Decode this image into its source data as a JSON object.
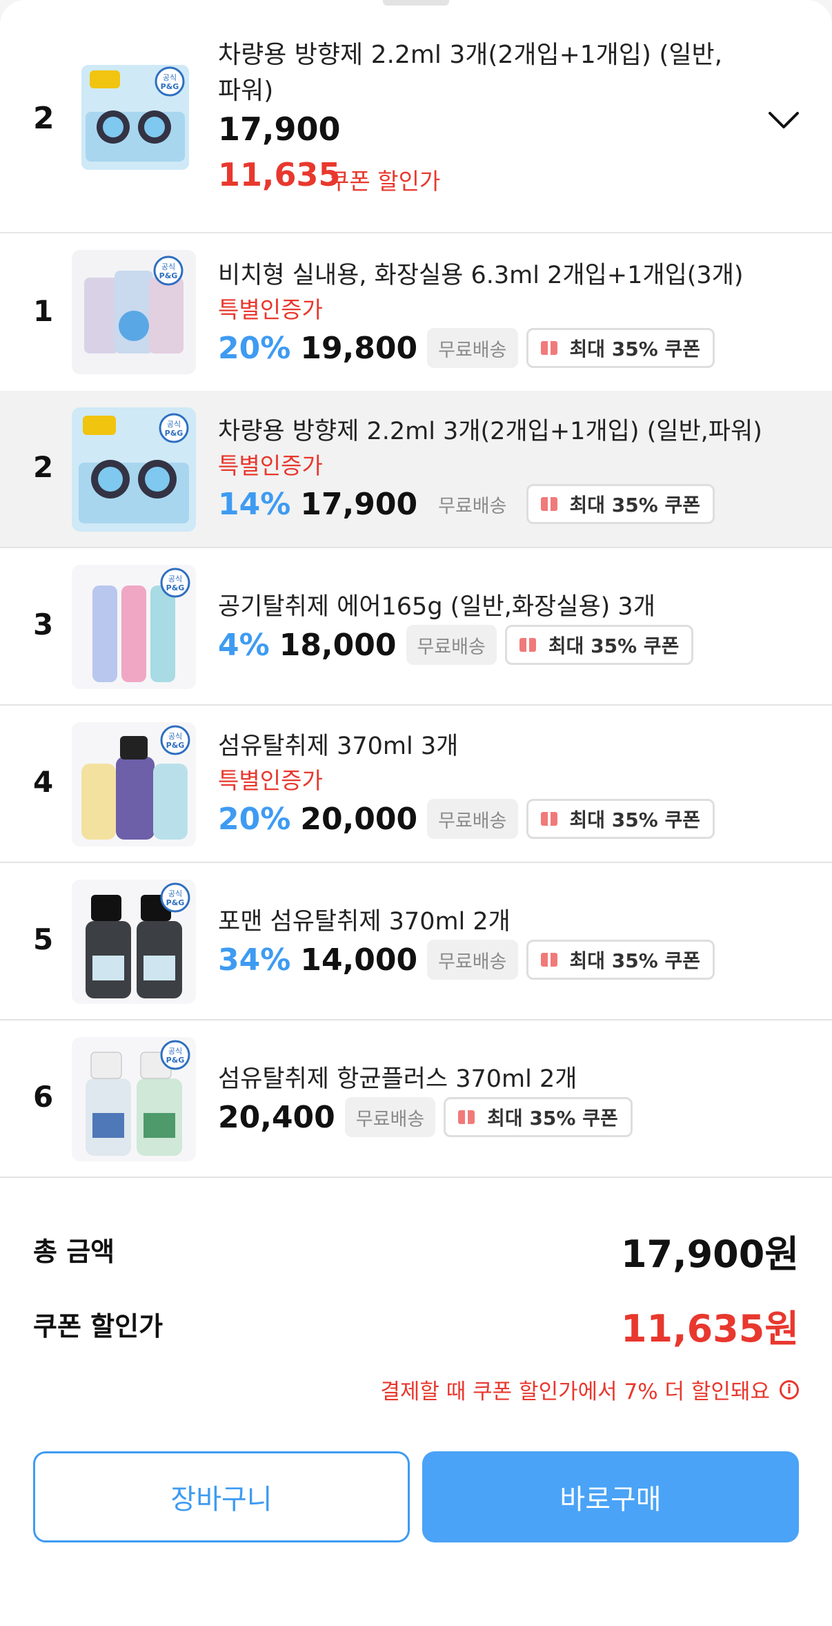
{
  "colors": {
    "accent_blue": "#3e9bf2",
    "accent_red": "#e8382e",
    "coupon_icon": "#f07a7a"
  },
  "selected": {
    "rank": "2",
    "title": "차량용 방향제 2.2ml 3개(2개입+1개입) (일반, 파워)",
    "price": "17,900",
    "coupon_price": "11,635",
    "coupon_label": "쿠폰 할인가",
    "icon": "chevron-down-icon"
  },
  "products": [
    {
      "rank": "1",
      "title": "비치형 실내용, 화장실용 6.3ml 2개입+1개입(3개)",
      "special": "특별인증가",
      "discount": "20%",
      "price": "19,800",
      "shipping": "무료배송",
      "coupon": "최대 35% 쿠폰"
    },
    {
      "rank": "2",
      "title": "차량용 방향제 2.2ml 3개(2개입+1개입) (일반,파워)",
      "special": "특별인증가",
      "discount": "14%",
      "price": "17,900",
      "shipping": "무료배송",
      "coupon": "최대 35% 쿠폰"
    },
    {
      "rank": "3",
      "title": "공기탈취제 에어165g (일반,화장실용) 3개",
      "special": "",
      "discount": "4%",
      "price": "18,000",
      "shipping": "무료배송",
      "coupon": "최대 35% 쿠폰"
    },
    {
      "rank": "4",
      "title": "섬유탈취제 370ml 3개",
      "special": "특별인증가",
      "discount": "20%",
      "price": "20,000",
      "shipping": "무료배송",
      "coupon": "최대 35% 쿠폰"
    },
    {
      "rank": "5",
      "title": "포맨 섬유탈취제 370ml 2개",
      "special": "",
      "discount": "34%",
      "price": "14,000",
      "shipping": "무료배송",
      "coupon": "최대 35% 쿠폰"
    },
    {
      "rank": "6",
      "title": "섬유탈취제 항균플러스 370ml 2개",
      "special": "",
      "discount": "",
      "price": "20,400",
      "shipping": "무료배송",
      "coupon": "최대 35% 쿠폰"
    }
  ],
  "totals": {
    "total_label": "총 금액",
    "total_value": "17,900원",
    "coupon_label": "쿠폰 할인가",
    "coupon_value": "11,635원",
    "note": "결제할 때 쿠폰 할인가에서 7% 더 할인돼요",
    "info_glyph": "i"
  },
  "buttons": {
    "cart": "장바구니",
    "buy": "바로구매"
  },
  "badges": {
    "official": "공식",
    "brand": "P&G"
  }
}
